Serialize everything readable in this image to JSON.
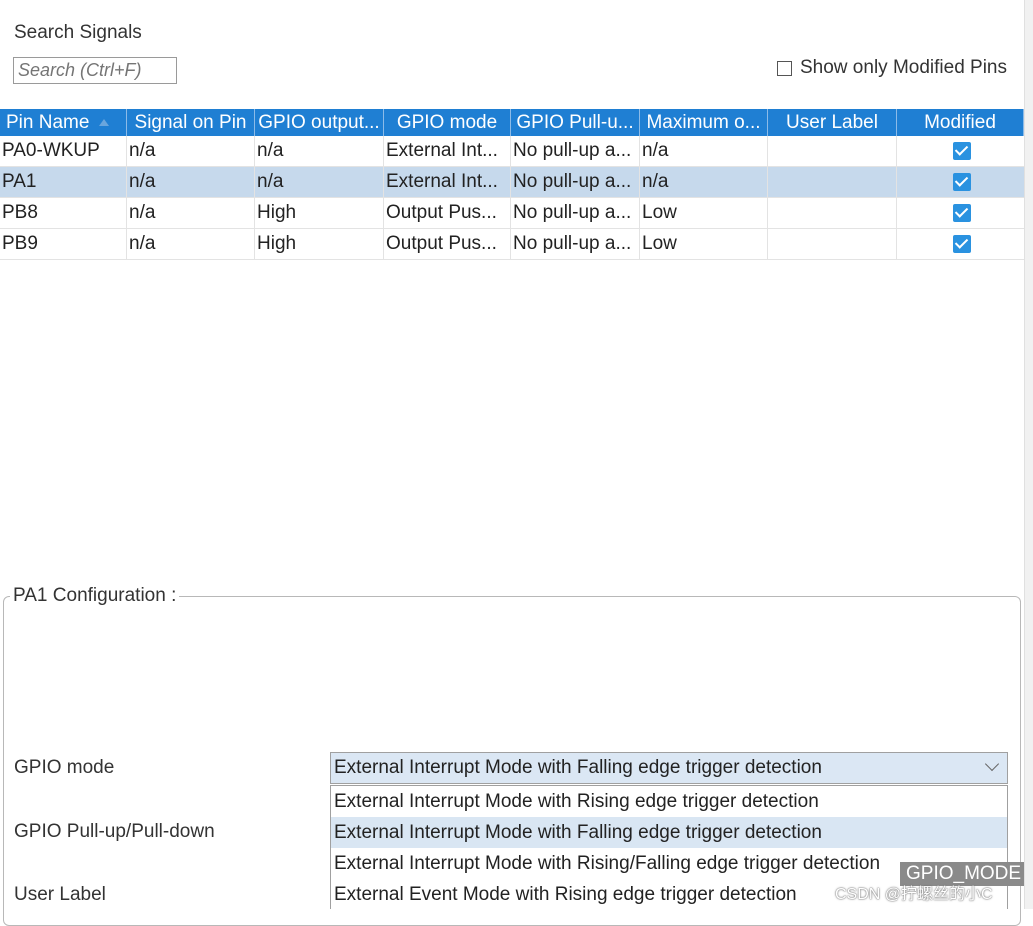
{
  "search": {
    "title": "Search Signals",
    "placeholder": "Search (Ctrl+F)"
  },
  "filter": {
    "show_modified_label": "Show only Modified Pins",
    "checked": false
  },
  "table": {
    "columns": [
      "Pin Name",
      "Signal on Pin",
      "GPIO output...",
      "GPIO mode",
      "GPIO Pull-u...",
      "Maximum o...",
      "User Label",
      "Modified"
    ],
    "sorted_column": "Pin Name",
    "rows": [
      {
        "pin": "PA0-WKUP",
        "signal": "n/a",
        "output": "n/a",
        "mode": "External Int...",
        "pull": "No pull-up a...",
        "max": "n/a",
        "label": "",
        "modified": true
      },
      {
        "pin": "PA1",
        "signal": "n/a",
        "output": "n/a",
        "mode": "External Int...",
        "pull": "No pull-up a...",
        "max": "n/a",
        "label": "",
        "modified": true,
        "selected": true
      },
      {
        "pin": "PB8",
        "signal": "n/a",
        "output": "High",
        "mode": "Output Pus...",
        "pull": "No pull-up a...",
        "max": "Low",
        "label": "",
        "modified": true
      },
      {
        "pin": "PB9",
        "signal": "n/a",
        "output": "High",
        "mode": "Output Pus...",
        "pull": "No pull-up a...",
        "max": "Low",
        "label": "",
        "modified": true
      }
    ]
  },
  "config": {
    "legend": "PA1 Configuration :",
    "gpio_mode_label": "GPIO mode",
    "pull_label": "GPIO Pull-up/Pull-down",
    "user_label_label": "User Label",
    "gpio_mode_value": "External Interrupt Mode with Falling edge trigger detection",
    "options": [
      "External Interrupt Mode with Rising edge trigger detection",
      "External Interrupt Mode with Falling edge trigger detection",
      "External Interrupt Mode with Rising/Falling edge trigger detection",
      "External Event Mode with Rising edge trigger detection"
    ],
    "highlighted_option": 1
  },
  "tooltip": "GPIO_MODE",
  "watermark": "CSDN @拧螺丝的小C"
}
